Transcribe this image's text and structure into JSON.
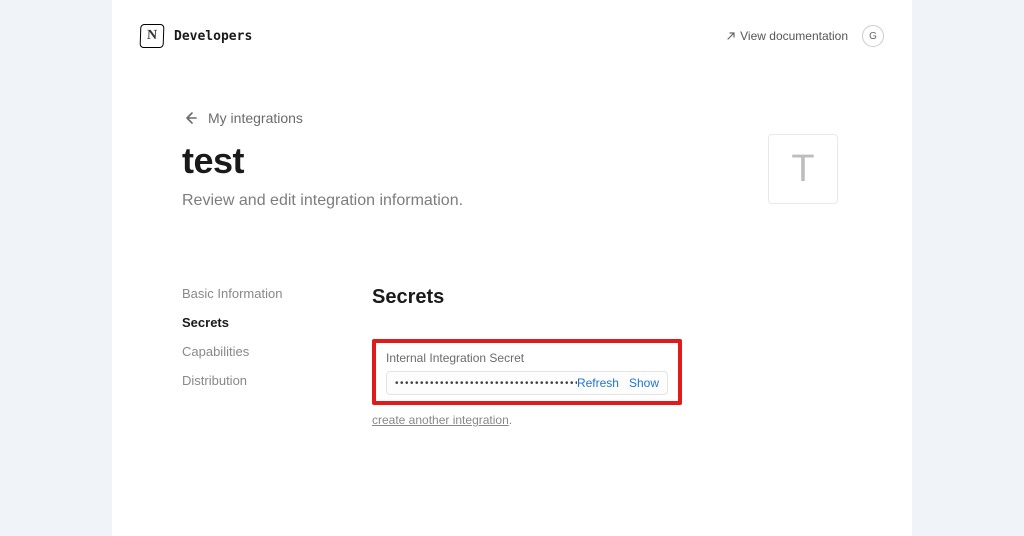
{
  "header": {
    "brand": "Developers",
    "doc_link": "View documentation",
    "avatar_initial": "G"
  },
  "breadcrumb": {
    "label": "My integrations"
  },
  "hero": {
    "title": "test",
    "subtitle": "Review and edit integration information.",
    "icon_letter": "T"
  },
  "sidebar": {
    "items": [
      {
        "label": "Basic Information",
        "active": false
      },
      {
        "label": "Secrets",
        "active": true
      },
      {
        "label": "Capabilities",
        "active": false
      },
      {
        "label": "Distribution",
        "active": false
      }
    ]
  },
  "main": {
    "section_heading": "Secrets",
    "secret_label": "Internal Integration Secret",
    "secret_masked": "•••••••••••••••••••••••••••••••••••••••••••••",
    "refresh_label": "Refresh",
    "show_label": "Show",
    "help_link": "create another integration"
  }
}
